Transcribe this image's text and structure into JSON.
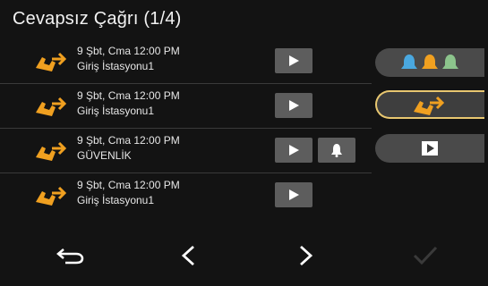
{
  "header": {
    "title": "Cevapsız Çağrı (1/4)"
  },
  "calls": [
    {
      "time": "9 Şbt, Cma 12:00 PM",
      "station": "Giriş İstasyonu1",
      "has_bell": false
    },
    {
      "time": "9 Şbt, Cma 12:00 PM",
      "station": "Giriş İstasyonu1",
      "has_bell": false
    },
    {
      "time": "9 Şbt, Cma 12:00 PM",
      "station": "GÜVENLİK",
      "has_bell": true
    },
    {
      "time": "9 Şbt, Cma 12:00 PM",
      "station": "Giriş İstasyonu1",
      "has_bell": false
    }
  ],
  "side_tabs": [
    {
      "name": "bells-tab",
      "icon": "colored-bells-icon"
    },
    {
      "name": "missed-call-tab",
      "icon": "missed-call-icon",
      "selected": true
    },
    {
      "name": "video-tab",
      "icon": "play-box-icon"
    }
  ],
  "bottom_nav": [
    "back-icon",
    "previous-icon",
    "next-icon",
    "check-icon"
  ],
  "colors": {
    "accent": "#f0a020",
    "selected_border": "#e8c770",
    "bell_blue": "#4aa8e0",
    "bell_orange": "#f0a020",
    "bell_green": "#8cc48c"
  }
}
